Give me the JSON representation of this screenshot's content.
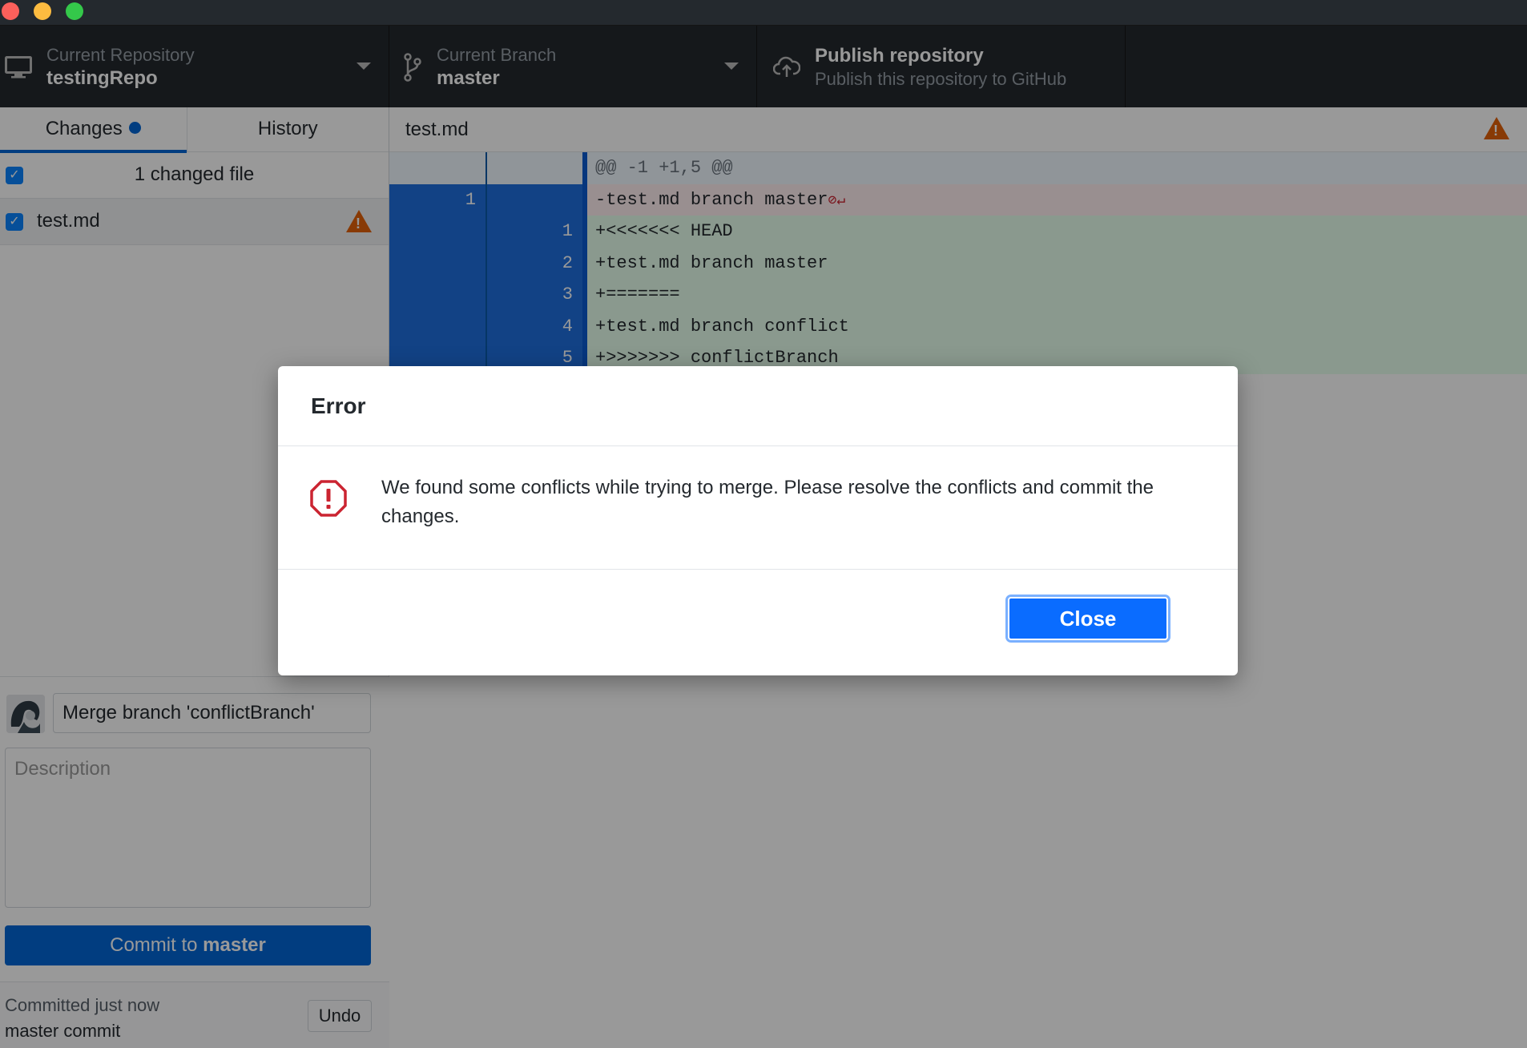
{
  "toolbar": {
    "repo_label": "Current Repository",
    "repo_name": "testingRepo",
    "branch_label": "Current Branch",
    "branch_name": "master",
    "publish_title": "Publish repository",
    "publish_subtitle": "Publish this repository to GitHub"
  },
  "sidebar": {
    "tabs": [
      {
        "label": "Changes",
        "active": true,
        "has_indicator": true
      },
      {
        "label": "History",
        "active": false
      }
    ],
    "changes_header": "1 changed file",
    "files": [
      {
        "name": "test.md",
        "checked": true,
        "status": "conflict-warning"
      }
    ]
  },
  "commit": {
    "summary_value": "Merge branch 'conflictBranch'",
    "description_placeholder": "Description",
    "button_prefix": "Commit to",
    "button_branch": "master",
    "last_commit_status": "Committed just now",
    "last_commit_message": "master commit",
    "undo_label": "Undo"
  },
  "diff": {
    "file_name": "test.md",
    "hunk_header": "@@ -1 +1,5 @@",
    "lines": [
      {
        "type": "del",
        "old": "1",
        "new": "",
        "text": "-test.md branch master"
      },
      {
        "type": "add",
        "old": "",
        "new": "1",
        "text": "+<<<<<<< HEAD"
      },
      {
        "type": "add",
        "old": "",
        "new": "2",
        "text": "+test.md branch master"
      },
      {
        "type": "add",
        "old": "",
        "new": "3",
        "text": "+======="
      },
      {
        "type": "add",
        "old": "",
        "new": "4",
        "text": "+test.md branch conflict"
      },
      {
        "type": "add",
        "old": "",
        "new": "5",
        "text": "+>>>>>>> conflictBranch"
      }
    ],
    "no_newline_marks": "⊘↵"
  },
  "dialog": {
    "title": "Error",
    "message": "We found some conflicts while trying to merge. Please resolve the conflicts and commit the changes.",
    "close_label": "Close"
  },
  "colors": {
    "accent": "#0366d6",
    "warning": "#e36209",
    "error": "#cb2431"
  }
}
